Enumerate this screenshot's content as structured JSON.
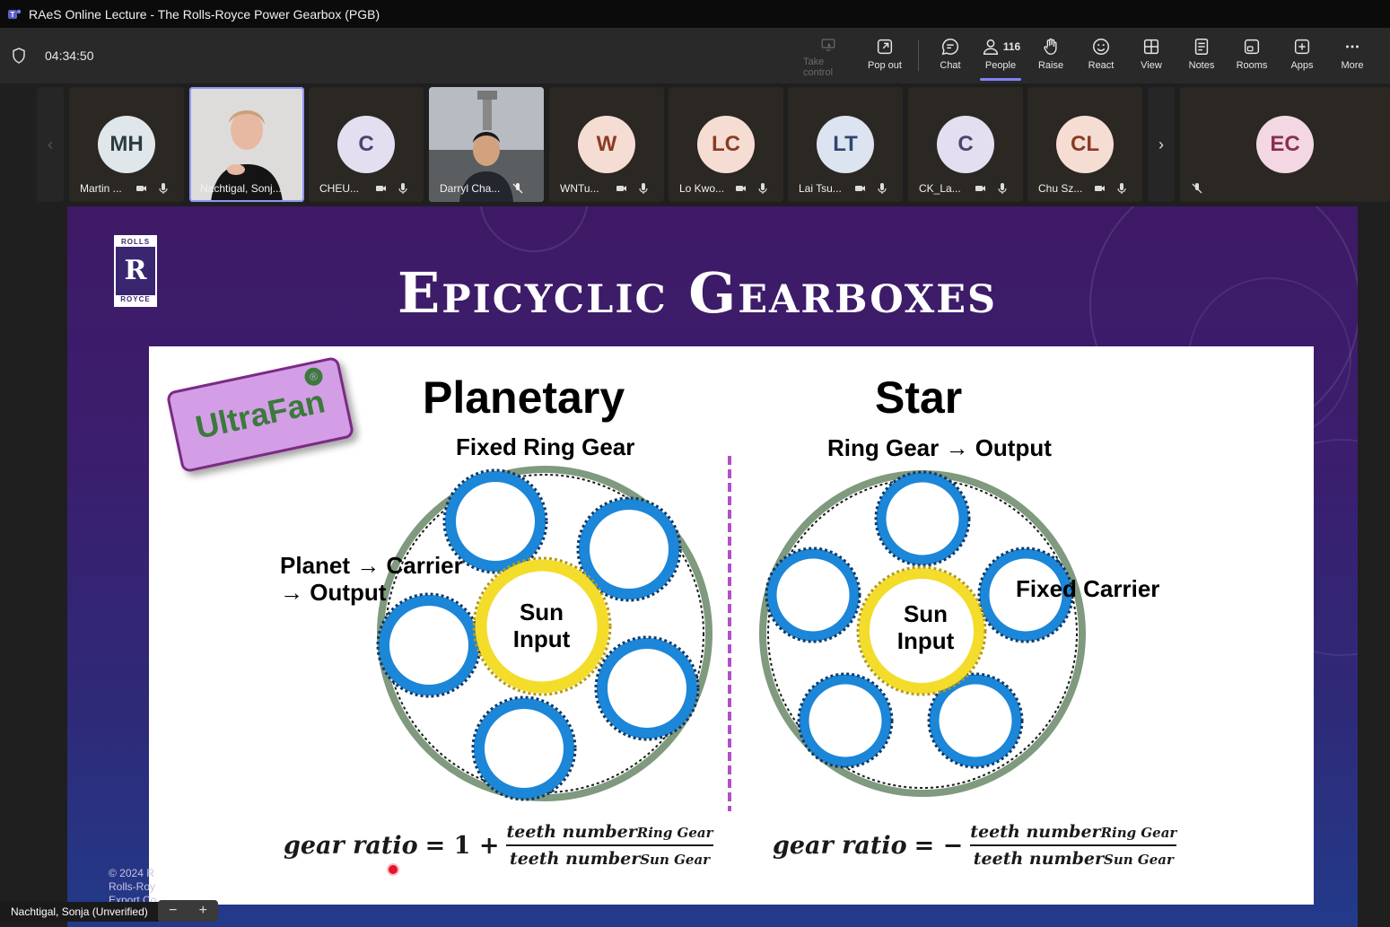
{
  "window": {
    "title": "RAeS Online Lecture - The Rolls-Royce Power Gearbox (PGB)"
  },
  "meeting": {
    "elapsed": "04:34:50"
  },
  "toolbar": {
    "take_control": "Take control",
    "pop_out": "Pop out",
    "chat": "Chat",
    "people": "People",
    "people_count": "116",
    "raise": "Raise",
    "react": "React",
    "view": "View",
    "notes": "Notes",
    "rooms": "Rooms",
    "apps": "Apps",
    "more": "More"
  },
  "participants": [
    {
      "initials": "MH",
      "name": "Martin ...",
      "bg": "#dfe7ea",
      "fg": "#2e3b40"
    },
    {
      "initials": "",
      "name": "Nachtigal, Sonj...",
      "bg": "",
      "fg": ""
    },
    {
      "initials": "C",
      "name": "CHEU...",
      "bg": "#e3dff0",
      "fg": "#4a4470"
    },
    {
      "initials": "",
      "name": "Darryl Cha...",
      "bg": "",
      "fg": ""
    },
    {
      "initials": "W",
      "name": "WNTu...",
      "bg": "#f6ddd3",
      "fg": "#8a3b23"
    },
    {
      "initials": "LC",
      "name": "Lo Kwo...",
      "bg": "#f6ddd3",
      "fg": "#8a3b23"
    },
    {
      "initials": "LT",
      "name": "Lai Tsu...",
      "bg": "#dbe4f0",
      "fg": "#2f4670"
    },
    {
      "initials": "C",
      "name": "CK_La...",
      "bg": "#e3dff0",
      "fg": "#4a4470"
    },
    {
      "initials": "CL",
      "name": "Chu Sz...",
      "bg": "#f6ddd3",
      "fg": "#8a3b23"
    }
  ],
  "overflow_participant": {
    "initials": "EC",
    "bg": "#f3d7e3",
    "fg": "#8a2d55"
  },
  "slide": {
    "title": "Epicyclic Gearboxes",
    "badge": "UltraFan",
    "badge_mark": "®",
    "planetary": {
      "heading": "Planetary",
      "ring_label": "Fixed Ring Gear",
      "carrier_line1": "Planet → Carrier",
      "carrier_line2": "→ Output",
      "sun_line1": "Sun",
      "sun_line2": "Input",
      "formula_lhs": "gear ratio",
      "formula_op": "= 1 +",
      "num": "teeth number",
      "num_sub": "Ring Gear",
      "den": "teeth number",
      "den_sub": "Sun Gear"
    },
    "star": {
      "heading": "Star",
      "ring_label": "Ring Gear → Output",
      "carrier": "Fixed Carrier",
      "sun_line1": "Sun",
      "sun_line2": "Input",
      "formula_lhs": "gear ratio",
      "formula_op": "= −",
      "num": "teeth number",
      "num_sub": "Ring Gear",
      "den": "teeth number",
      "den_sub": "Sun Gear"
    },
    "copyright_l1": "© 2024 R",
    "copyright_l2": "Rolls-Roy",
    "copyright_l3": "Export Co",
    "logo_top": "ROLLS",
    "logo_bottom": "ROYCE"
  },
  "presenter": {
    "label": "Nachtigal, Sonja (Unverified)"
  },
  "zoom": {
    "minus": "−",
    "plus": "+"
  },
  "colors": {
    "accent": "#7f85f5",
    "gear_blue": "#1c86d8",
    "gear_yellow": "#f4dc2a",
    "ring_green": "#7f9a7e"
  }
}
